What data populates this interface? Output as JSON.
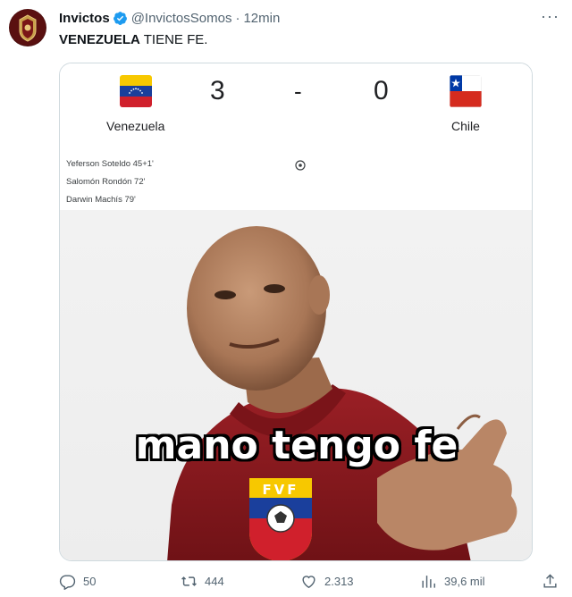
{
  "author": {
    "name": "Invictos",
    "handle": "@InvictosSomos",
    "separator": "·",
    "time": "12min",
    "avatar_icon": "team-crest-icon",
    "verified_icon": "verified-badge-icon"
  },
  "tweet": {
    "text_bold": "VENEZUELA",
    "text_rest": " TIENE FE."
  },
  "match": {
    "home_team": "Venezuela",
    "away_team": "Chile",
    "home_score": "3",
    "away_score": "0",
    "separator": "-",
    "scorers": [
      "Yeferson Soteldo 45+1'",
      "Salomón Rondón 72'",
      "Darwin Machís 79'"
    ],
    "goal_icon": "soccer-ball-icon"
  },
  "meme": {
    "caption": "mano tengo fe",
    "badge_text": "FVF"
  },
  "actions": {
    "replies": "50",
    "retweets": "444",
    "likes": "2.313",
    "views": "39,6 mil"
  },
  "colors": {
    "verified": "#1d9bf0",
    "muted": "#536471",
    "jersey": "#8b1a1f",
    "venezuela_yellow": "#f7c800",
    "venezuela_blue": "#1a3f9c",
    "venezuela_red": "#d0202c"
  }
}
